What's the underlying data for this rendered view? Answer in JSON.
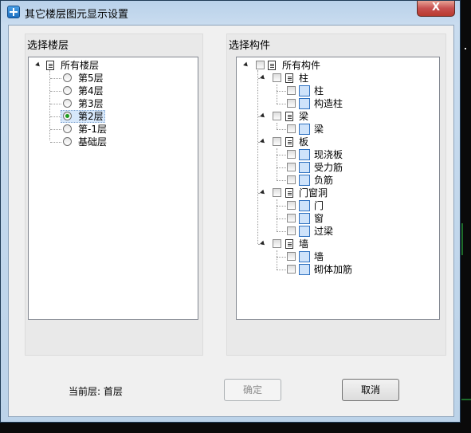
{
  "window": {
    "title": "其它楼层图元显示设置",
    "close_label": "X"
  },
  "floors": {
    "title": "选择楼层",
    "root_label": "所有楼层",
    "items": [
      {
        "label": "第5层",
        "checked": false
      },
      {
        "label": "第4层",
        "checked": false
      },
      {
        "label": "第3层",
        "checked": false
      },
      {
        "label": "第2层",
        "checked": true
      },
      {
        "label": "第-1层",
        "checked": false
      },
      {
        "label": "基础层",
        "checked": false
      }
    ]
  },
  "components": {
    "title": "选择构件",
    "root_label": "所有构件",
    "groups": [
      {
        "label": "柱",
        "children": [
          {
            "label": "柱",
            "icon": "column-icon"
          },
          {
            "label": "构造柱",
            "icon": "constructional-column-icon"
          }
        ]
      },
      {
        "label": "梁",
        "children": [
          {
            "label": "梁",
            "icon": "beam-icon"
          }
        ]
      },
      {
        "label": "板",
        "children": [
          {
            "label": "现浇板",
            "icon": "cast-slab-icon"
          },
          {
            "label": "受力筋",
            "icon": "main-rebar-icon"
          },
          {
            "label": "负筋",
            "icon": "negative-rebar-icon"
          }
        ]
      },
      {
        "label": "门窗洞",
        "children": [
          {
            "label": "门",
            "icon": "door-icon"
          },
          {
            "label": "窗",
            "icon": "window-icon"
          },
          {
            "label": "过梁",
            "icon": "lintel-icon"
          }
        ]
      },
      {
        "label": "墙",
        "children": [
          {
            "label": "墙",
            "icon": "wall-icon"
          },
          {
            "label": "砌体加筋",
            "icon": "masonry-rebar-icon"
          }
        ]
      }
    ]
  },
  "footer": {
    "current_floor_label": "当前层: 首层",
    "ok_label": "确定",
    "cancel_label": "取消"
  }
}
